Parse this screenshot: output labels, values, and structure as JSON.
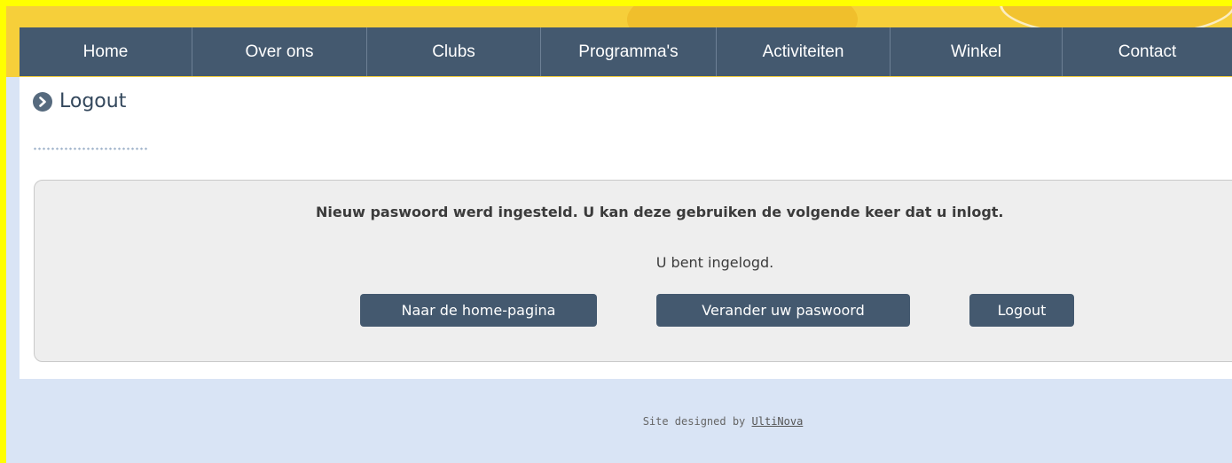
{
  "nav": {
    "items": [
      {
        "label": "Home"
      },
      {
        "label": "Over ons"
      },
      {
        "label": "Clubs"
      },
      {
        "label": "Programma's"
      },
      {
        "label": "Activiteiten"
      },
      {
        "label": "Winkel"
      },
      {
        "label": "Contact"
      }
    ]
  },
  "page": {
    "title": "Logout",
    "title_icon": "arrow-right-circle-icon"
  },
  "message": {
    "bold": "Nieuw paswoord werd ingesteld. U kan deze gebruiken de volgende keer dat u inlogt.",
    "normal": "U bent ingelogd."
  },
  "buttons": {
    "home": "Naar de home-pagina",
    "change_password": "Verander uw paswoord",
    "logout": "Logout"
  },
  "footer": {
    "text": "Site designed by ",
    "link": "UltiNova"
  },
  "colors": {
    "accent": "#44596f",
    "header_yellow": "#f6cf3a",
    "background_blue": "#d9e4f5"
  }
}
